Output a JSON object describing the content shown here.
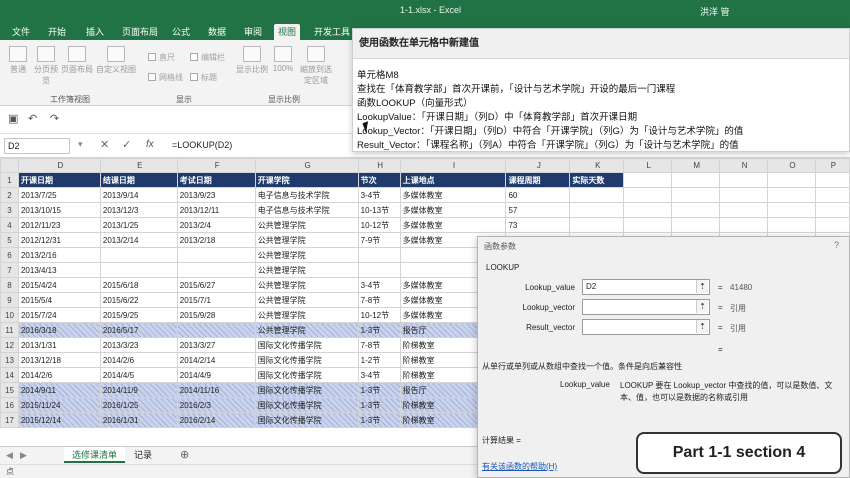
{
  "window": {
    "title": "1-1.xlsx - Excel",
    "user": "洪洋 管"
  },
  "ribbon_tabs": [
    "文件",
    "开始",
    "插入",
    "页面布局",
    "公式",
    "数据",
    "审阅",
    "视图",
    "开发工具"
  ],
  "ribbon": {
    "buttons": [
      "普通",
      "分页预览",
      "页面布局",
      "自定义视图",
      "显示比例",
      "100%",
      "缩放到选定区域"
    ],
    "checks": [
      "直尺",
      "编辑栏",
      "网格线",
      "标题"
    ],
    "groups": [
      "工作簿视图",
      "显示",
      "显示比例"
    ]
  },
  "formula_bar": {
    "name_box": "D2",
    "fx": "fx",
    "formula": "=LOOKUP(D2)"
  },
  "columns": [
    "D",
    "E",
    "F",
    "G",
    "H",
    "I",
    "J",
    "K",
    "L",
    "M",
    "N",
    "O",
    "P"
  ],
  "header_row": [
    "开课日期",
    "结课日期",
    "考试日期",
    "开课学院",
    "节次",
    "上课地点",
    "课程周期",
    "实际天数"
  ],
  "rows": [
    {
      "n": "2",
      "c": [
        "2013/7/25",
        "2013/9/14",
        "2013/9/23",
        "电子信息与技术学院",
        "3-4节",
        "多媒体教室",
        "60",
        ""
      ]
    },
    {
      "n": "3",
      "c": [
        "2013/10/15",
        "2013/12/3",
        "2013/12/11",
        "电子信息与技术学院",
        "10-13节",
        "多媒体教室",
        "57",
        ""
      ]
    },
    {
      "n": "4",
      "c": [
        "2012/11/23",
        "2013/1/25",
        "2013/2/4",
        "公共管理学院",
        "10-12节",
        "多媒体教室",
        "73",
        ""
      ]
    },
    {
      "n": "5",
      "c": [
        "2012/12/31",
        "2013/2/14",
        "2013/2/18",
        "公共管理学院",
        "7-9节",
        "多媒体教室",
        "",
        ""
      ]
    },
    {
      "n": "6",
      "c": [
        "2013/2/16",
        "",
        "",
        "公共管理学院",
        "",
        "",
        "",
        ""
      ]
    },
    {
      "n": "7",
      "c": [
        "2013/4/13",
        "",
        "",
        "公共管理学院",
        "",
        "",
        "",
        ""
      ]
    },
    {
      "n": "8",
      "c": [
        "2015/4/24",
        "2015/6/18",
        "2015/6/27",
        "公共管理学院",
        "3-4节",
        "多媒体教室",
        "",
        ""
      ]
    },
    {
      "n": "9",
      "c": [
        "2015/5/4",
        "2015/6/22",
        "2015/7/1",
        "公共管理学院",
        "7-8节",
        "多媒体教室",
        "",
        ""
      ]
    },
    {
      "n": "10",
      "c": [
        "2015/7/24",
        "2015/9/25",
        "2015/9/28",
        "公共管理学院",
        "10-12节",
        "多媒体教室",
        "",
        ""
      ]
    },
    {
      "n": "11",
      "c": [
        "2016/3/18",
        "2016/5/17",
        "",
        "公共管理学院",
        "1-3节",
        "报告厅",
        "",
        ""
      ],
      "hl": true
    },
    {
      "n": "12",
      "c": [
        "2013/1/31",
        "2013/3/23",
        "2013/3/27",
        "国际文化传播学院",
        "7-8节",
        "阶梯教室",
        "",
        ""
      ]
    },
    {
      "n": "13",
      "c": [
        "2013/12/18",
        "2014/2/6",
        "2014/2/14",
        "国际文化传播学院",
        "1-2节",
        "阶梯教室",
        "",
        ""
      ]
    },
    {
      "n": "14",
      "c": [
        "2014/2/6",
        "2014/4/5",
        "2014/4/9",
        "国际文化传播学院",
        "3-4节",
        "阶梯教室",
        "",
        ""
      ]
    },
    {
      "n": "15",
      "c": [
        "2014/9/11",
        "2014/11/9",
        "2014/11/16",
        "国际文化传播学院",
        "1-3节",
        "报告厅",
        "",
        ""
      ],
      "hl": true
    },
    {
      "n": "16",
      "c": [
        "2015/11/24",
        "2016/1/25",
        "2016/2/3",
        "国际文化传播学院",
        "1-3节",
        "阶梯教室",
        "",
        ""
      ],
      "hl": true
    },
    {
      "n": "17",
      "c": [
        "2015/12/14",
        "2016/1/31",
        "2016/2/14",
        "国际文化传播学院",
        "1-3节",
        "阶梯教室",
        "",
        ""
      ],
      "hl": true
    }
  ],
  "sheet_tabs": [
    "选修课清单",
    "记录"
  ],
  "add_sheet": "⊕",
  "status_text": "点",
  "note": {
    "title": "使用函数在单元格中新建值",
    "lines": [
      "单元格M8",
      "查找在「体育教学部」首次开课前，「设计与艺术学院」开设的最后一门课程",
      "函数LOOKUP（向量形式）",
      "LookupValue：「开课日期」（列D）中「体育教学部」首次开课日期",
      "Lookup_Vector：「开课日期」（列D）中符合「开课学院」（列G）为「设计与艺术学院」的值",
      "Result_Vector：「课程名称」（列A）中符合「开课学院」（列G）为「设计与艺术学院」的值"
    ]
  },
  "dialog": {
    "title": "函数参数",
    "help_q": "?",
    "function_name": "LOOKUP",
    "args": [
      {
        "label": "Lookup_value",
        "value": "D2",
        "result": "41480"
      },
      {
        "label": "Lookup_vector",
        "value": "",
        "result": "引用"
      },
      {
        "label": "Result_vector",
        "value": "",
        "result": "引用"
      }
    ],
    "eq": "=",
    "description": "从单行或单列或从数组中查找一个值。条件是向后兼容性",
    "param_label": "Lookup_value",
    "param_desc": "LOOKUP 要在 Lookup_vector 中查找的值，可以是数值、文本、值，也可以是数据的名称或引用",
    "calc_result": "计算结果 =",
    "help_link": "有关该函数的帮助(H)"
  },
  "overlay": {
    "part": "Part 1-1 section 4"
  }
}
